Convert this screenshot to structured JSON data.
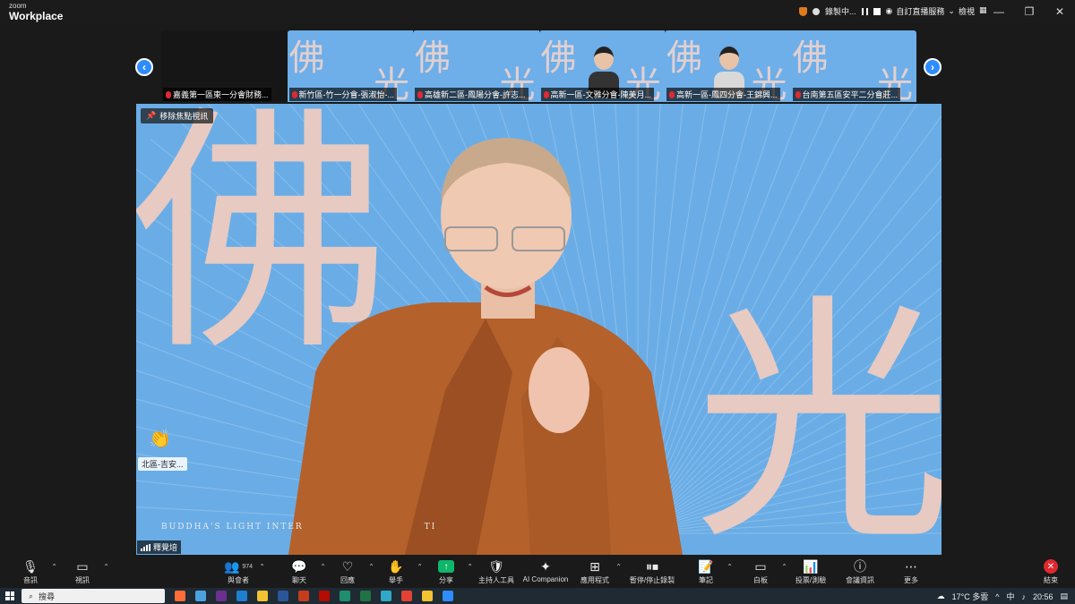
{
  "titlebar": {
    "brand_top": "zoom",
    "brand_main": "Workplace",
    "recording_label": "錄製中...",
    "live_label": "自訂直播服務",
    "view_label": "檢視"
  },
  "gallery": {
    "tiles": [
      {
        "name": "嘉義第一區東一分會財務...",
        "video": false
      },
      {
        "name": "新竹區-竹一分會-張淑怡-...",
        "video": true,
        "person": "none"
      },
      {
        "name": "高雄新二區-鳳陽分會-許志...",
        "video": true,
        "person": "none"
      },
      {
        "name": "高新一區-文雅分會-陳美月...",
        "video": true,
        "person": "female"
      },
      {
        "name": "高新一區-鳳四分會-王錦興...",
        "video": true,
        "person": "male"
      },
      {
        "name": "台南第五區安平二分會莊...",
        "video": true,
        "person": "none"
      }
    ]
  },
  "stage": {
    "pin_label": "移除焦點視訊",
    "backdrop_char_1": "佛",
    "backdrop_char_2": "光",
    "backdrop_text": "BUDDHA'S LIGHT INTER",
    "backdrop_text_tail": "TI",
    "reaction_user": "北區-吉安...",
    "speaker_name": "釋覺培"
  },
  "toolbar": {
    "audio": "音訊",
    "video": "視訊",
    "participants": "與會者",
    "participants_count": "974",
    "chat": "聊天",
    "reactions": "回應",
    "raise_hand": "舉手",
    "share": "分享",
    "host_tools": "主持人工具",
    "ai_companion": "AI Companion",
    "apps": "應用程式",
    "record": "暫停/停止錄製",
    "notes": "筆記",
    "whiteboard": "白板",
    "polls": "投票/測驗",
    "meeting_info": "會議資訊",
    "more": "更多",
    "end": "結束"
  },
  "taskbar": {
    "search": "搜尋",
    "weather": "17°C 多雲",
    "ime": "中",
    "time": "20:56"
  },
  "colors": {
    "accent": "#2d8cff",
    "stage_bg": "#6aade6",
    "mute_red": "#e0282f",
    "share_green": "#0fb66a"
  }
}
